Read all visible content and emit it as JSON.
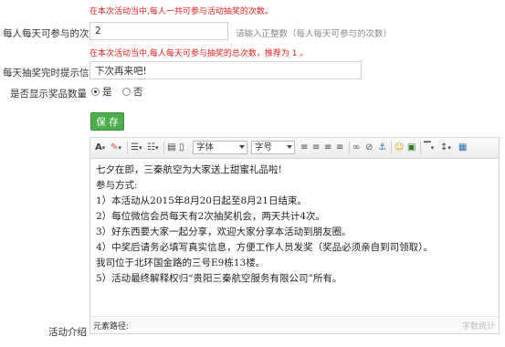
{
  "top_note": "在本次活动当中,每人一共可参与活动抽奖的次数。",
  "daily_count": {
    "label": "每人每天可参与的次数",
    "value": "2",
    "hint": "请输入正整数（每人每天可参与的次数）",
    "note": "在本次活动当中,每人每天可参与抽奖的总次数，推荐为 1 。"
  },
  "tip_message": {
    "label": "每天抽奖完时提示信息",
    "value": "下次再来吧!"
  },
  "show_prize_count": {
    "label": "是否显示奖品数量",
    "options": [
      "是",
      "否"
    ],
    "selected": "是"
  },
  "save_button": "保 存",
  "toolbar": {
    "font_family": "字体",
    "font_size": "字号",
    "icons": [
      "font-color-icon",
      "highlight-icon",
      "ordered-list-icon",
      "unordered-list-icon",
      "paste-icon",
      "source-icon",
      "align-left-icon",
      "align-center-icon",
      "align-right-icon",
      "justify-icon",
      "link-icon",
      "unlink-icon",
      "anchor-icon",
      "emotion-icon",
      "image-icon",
      "horizontal-rule-icon",
      "line-height-icon",
      "table-icon"
    ]
  },
  "editor": {
    "lines": [
      "七夕在即，三秦航空为大家送上甜蜜礼品啦!",
      "参与方式:",
      "1）本活动从2015年8月20日起至8月21日结束。",
      "2）每位微信会员每天有2次抽奖机会，两天共计4次。",
      "3）好东西要大家一起分享，欢迎大家分享本活动到朋友圈。",
      "4）中奖后请务必填写真实信息，方便工作人员发奖（奖品必须亲自到司领取）。",
      "我司位于北环国金路的三号E9栋13楼。",
      "5）活动最终解释权归“贵阳三秦航空服务有限公司”所有。"
    ],
    "path_label": "元素路径:",
    "word_count": "字数统计"
  },
  "activity_intro_label": "活动介绍"
}
